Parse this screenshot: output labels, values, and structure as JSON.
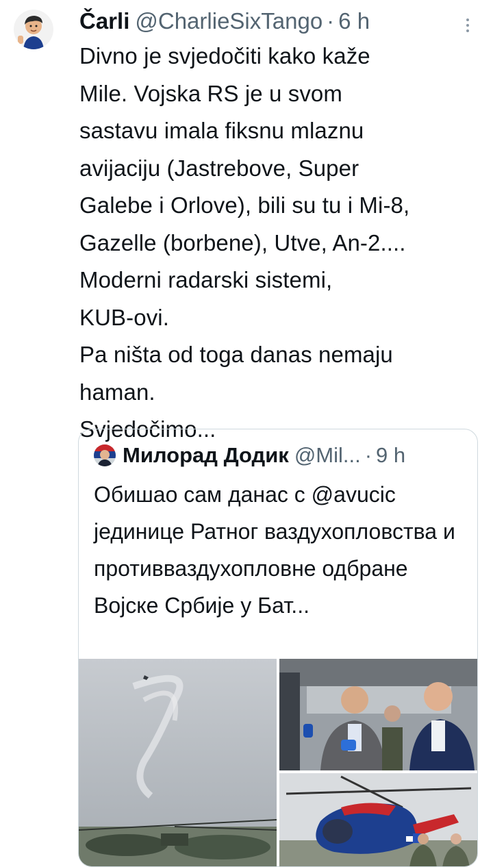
{
  "tweet": {
    "author_name": "Čarli",
    "handle": "@CharlieSixTango",
    "separator": "·",
    "time": "6 h",
    "text": "Divno je svjedočiti kako kaže\nMile. Vojska RS je u svom\nsastavu imala fiksnu mlaznu\navijaciju (Jastrebove, Super\nGalebe i Orlove), bili su tu i Mi-8,\nGazelle (borbene), Utve, An-2....\nModerni radarski sistemi,\nKUB-ovi.\nPa ništa od toga danas nemaju\nhaman.\nSvjedočimo...",
    "more_icon": "more-options-icon"
  },
  "quoted": {
    "author_name": "Милорад Додик",
    "handle": "@Mil...",
    "separator": "·",
    "time": "9 h",
    "text": "Обишао сам данас с @avucic јединице Ратног ваздухопловства и противваздухопловне одбране Војске Србије у Бат..."
  },
  "colors": {
    "text": "#0f1419",
    "secondary": "#536471",
    "border": "#cfd9de",
    "helicopter_blue": "#1d3f8f",
    "helicopter_red": "#c8282c"
  }
}
